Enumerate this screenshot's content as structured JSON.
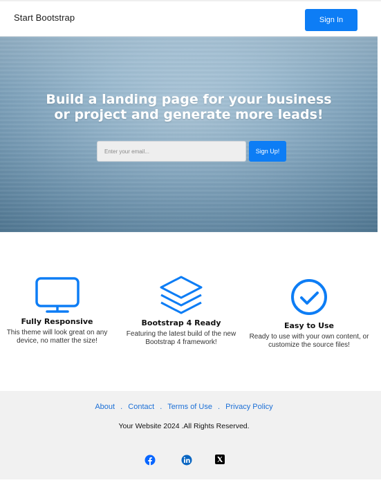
{
  "navbar": {
    "brand": "Start Bootstrap",
    "signin_label": "Sign In",
    "accent": "#0d7df5"
  },
  "hero": {
    "title_line1": "Build a landing page for your business",
    "title_line2": "or project and generate more leads!",
    "email_placeholder": "Enter your email...",
    "email_value": "",
    "signup_label": "Sign Up!"
  },
  "features": [
    {
      "icon": "monitor-icon",
      "title": "Fully Responsive",
      "text": "This theme will look great on any device, no matter the size!"
    },
    {
      "icon": "layers-icon",
      "title": "Bootstrap 4 Ready",
      "text": "Featuring the latest build of the new Bootstrap 4 framework!"
    },
    {
      "icon": "check-circle-icon",
      "title": "Easy to Use",
      "text": "Ready to use with your own content, or customize the source files!"
    }
  ],
  "footer": {
    "links": [
      "About",
      "Contact",
      "Terms of Use",
      "Privacy Policy"
    ],
    "separator": ".",
    "copyright": "Your Website 2024 .All Rights Reserved.",
    "social": [
      "facebook-icon",
      "linkedin-icon",
      "x-icon"
    ],
    "link_color": "#1b6fd6"
  }
}
